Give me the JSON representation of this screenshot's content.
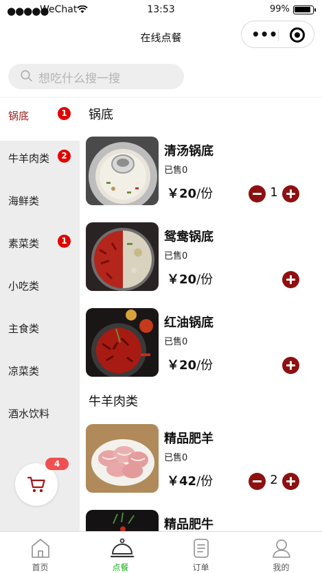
{
  "status_bar": {
    "signal": "●●●●●",
    "carrier": "WeChat",
    "time": "13:53",
    "battery": "99%"
  },
  "nav": {
    "title": "在线点餐"
  },
  "search": {
    "placeholder": "想吃什么搜一搜"
  },
  "categories": [
    {
      "label": "锅底",
      "badge": "1",
      "active": true
    },
    {
      "label": "牛羊肉类",
      "badge": "2"
    },
    {
      "label": "海鲜类"
    },
    {
      "label": "素菜类",
      "badge": "1"
    },
    {
      "label": "小吃类"
    },
    {
      "label": "主食类"
    },
    {
      "label": "凉菜类"
    },
    {
      "label": "酒水饮料"
    }
  ],
  "cart": {
    "count": "4"
  },
  "sections": [
    {
      "title": "锅底",
      "dishes": [
        {
          "name": "清汤锅底",
          "sold": "已售0",
          "currency": "￥",
          "price": "20",
          "unit": "/份",
          "qty": "1"
        },
        {
          "name": "鸳鸯锅底",
          "sold": "已售0",
          "currency": "￥",
          "price": "20",
          "unit": "/份"
        },
        {
          "name": "红油锅底",
          "sold": "已售0",
          "currency": "￥",
          "price": "20",
          "unit": "/份"
        }
      ]
    },
    {
      "title": "牛羊肉类",
      "dishes": [
        {
          "name": "精品肥羊",
          "sold": "已售0",
          "currency": "￥",
          "price": "42",
          "unit": "/份",
          "qty": "2"
        },
        {
          "name": "精品肥牛"
        }
      ]
    }
  ],
  "tabbar": [
    {
      "label": "首页",
      "icon": "home-icon"
    },
    {
      "label": "点餐",
      "icon": "dish-cover-icon",
      "active": true
    },
    {
      "label": "订单",
      "icon": "order-list-icon"
    },
    {
      "label": "我的",
      "icon": "user-icon"
    }
  ],
  "colors": {
    "accent": "#8e1010",
    "badge": "#e10000",
    "tab_active": "#1aad19"
  }
}
